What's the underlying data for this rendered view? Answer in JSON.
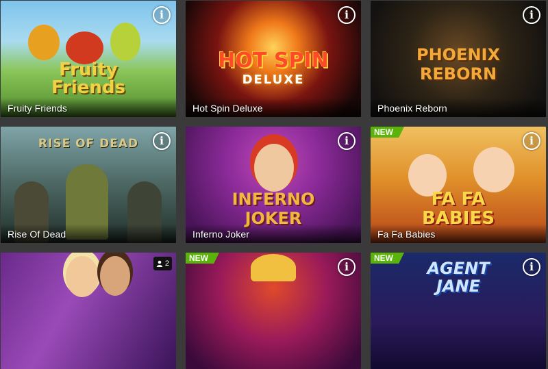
{
  "tiles": [
    {
      "name": "Fruity Friends",
      "logo_line1": "Fruity",
      "logo_line2": "Friends"
    },
    {
      "name": "Hot Spin Deluxe",
      "logo_line1": "HOT SPIN",
      "logo_line2": "DELUXE"
    },
    {
      "name": "Phoenix Reborn",
      "logo_line1": "PHOENIX",
      "logo_line2": "REBORN"
    },
    {
      "name": "Rise Of Dead",
      "logo_line1": "RISE OF DEAD"
    },
    {
      "name": "Inferno Joker",
      "logo_line1": "INFERNO",
      "logo_line2": "JOKER"
    },
    {
      "name": "Fa Fa Babies",
      "logo_line1": "FA FA",
      "logo_line2": "BABIES",
      "badge": "NEW"
    },
    {
      "players": "2"
    },
    {
      "badge": "NEW"
    },
    {
      "badge": "NEW",
      "logo_line1": "AGENT",
      "logo_line2": "JANE"
    }
  ],
  "info_glyph": "i",
  "icons": {
    "info": "info-icon",
    "players": "user-icon"
  },
  "colors": {
    "background": "#3a3a3a",
    "new_badge": "#5ab30b",
    "caption_text": "#ffffff"
  }
}
